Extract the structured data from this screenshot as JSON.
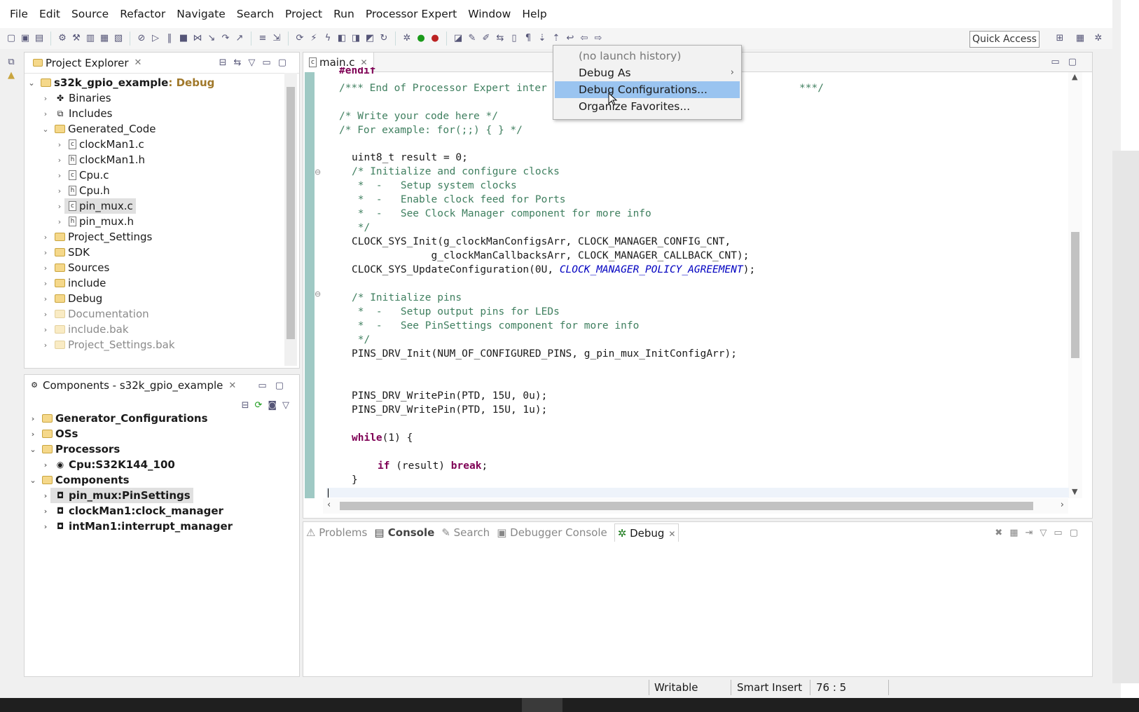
{
  "menu": [
    "File",
    "Edit",
    "Source",
    "Refactor",
    "Navigate",
    "Search",
    "Project",
    "Run",
    "Processor Expert",
    "Window",
    "Help"
  ],
  "quick_access": "Quick Access",
  "project_explorer": {
    "title": "Project Explorer",
    "root": "s32k_gpio_example",
    "root_suffix": ": Debug",
    "items": [
      "Binaries",
      "Includes",
      "Generated_Code",
      "clockMan1.c",
      "clockMan1.h",
      "Cpu.c",
      "Cpu.h",
      "pin_mux.c",
      "pin_mux.h",
      "Project_Settings",
      "SDK",
      "Sources",
      "include",
      "Debug",
      "Documentation",
      "include.bak",
      "Project_Settings.bak"
    ]
  },
  "components": {
    "title": "Components - s32k_gpio_example",
    "items": [
      "Generator_Configurations",
      "OSs",
      "Processors",
      "Cpu:S32K144_100",
      "Components",
      "pin_mux:PinSettings",
      "clockMan1:clock_manager",
      "intMan1:interrupt_manager"
    ]
  },
  "editor": {
    "tab": "main.c",
    "lines": [
      "#endif",
      "/*** End of Processor Expert inter",
      "***/",
      "/* Write your code here */",
      "/* For example: for(;;) { } */",
      "uint8_t result = 0;",
      "/* Initialize and configure clocks",
      " *  -   Setup system clocks",
      " *  -   Enable clock feed for Ports",
      " *  -   See Clock Manager component for more info",
      " */",
      "CLOCK_SYS_Init(g_clockManConfigsArr, CLOCK_MANAGER_CONFIG_CNT,",
      "             g_clockManCallbacksArr, CLOCK_MANAGER_CALLBACK_CNT);",
      "CLOCK_SYS_UpdateConfiguration(0U, ",
      "CLOCK_MANAGER_POLICY_AGREEMENT",
      ");",
      "/* Initialize pins",
      " *  -   Setup output pins for LEDs",
      " *  -   See PinSettings component for more info",
      " */",
      "PINS_DRV_Init(NUM_OF_CONFIGURED_PINS, g_pin_mux_InitConfigArr);",
      "PINS_DRV_WritePin(PTD, 15U, 0u);",
      "PINS_DRV_WritePin(PTD, 15U, 1u);",
      "while",
      "(1) {",
      "if",
      " (result) ",
      "break",
      ";",
      "}"
    ]
  },
  "context_menu": {
    "items": [
      "(no launch history)",
      "Debug As",
      "Debug Configurations...",
      "Organize Favorites..."
    ]
  },
  "bottom_tabs": [
    "Problems",
    "Console",
    "Search",
    "Debugger Console",
    "Debug"
  ],
  "status": {
    "writable": "Writable",
    "insert": "Smart Insert",
    "position": "76 : 5"
  },
  "colors": {
    "comment": "#3f7f5f",
    "keyword": "#7f0055",
    "constant": "#0000c0",
    "menu_highlight": "#9ac4f0",
    "folder": "#f5d88a"
  }
}
